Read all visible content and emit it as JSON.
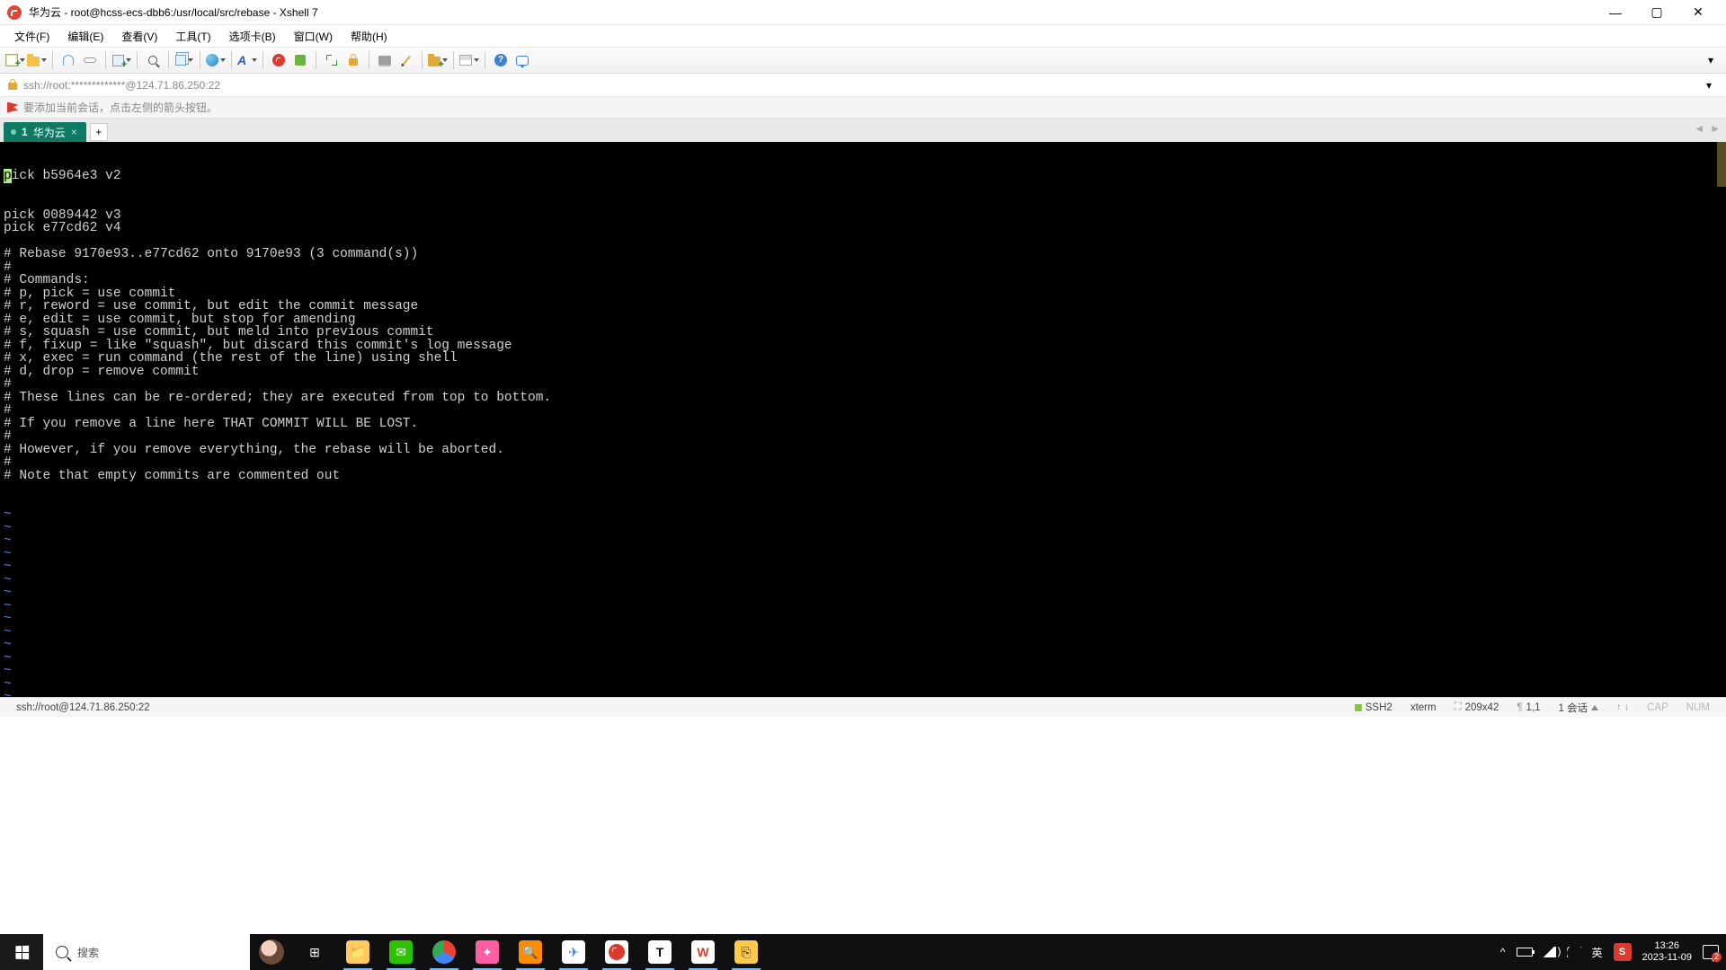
{
  "window": {
    "title": "华为云 - root@hcss-ecs-dbb6:/usr/local/src/rebase - Xshell 7",
    "minimize": "—",
    "maximize": "▢",
    "close": "✕"
  },
  "menu": {
    "file": "文件(F)",
    "edit": "编辑(E)",
    "view": "查看(V)",
    "tools": "工具(T)",
    "tabs": "选项卡(B)",
    "window": "窗口(W)",
    "help": "帮助(H)"
  },
  "address": "ssh://root:*************@124.71.86.250:22",
  "hint": "要添加当前会话，点击左侧的箭头按钮。",
  "tab": {
    "index": "1",
    "label": "华为云",
    "close": "×",
    "add": "+"
  },
  "terminal": {
    "cursor_line_prefix_char": "p",
    "cursor_line_suffix": "ick b5964e3 v2",
    "lines": [
      "pick 0089442 v3",
      "pick e77cd62 v4",
      "",
      "# Rebase 9170e93..e77cd62 onto 9170e93 (3 command(s))",
      "#",
      "# Commands:",
      "# p, pick = use commit",
      "# r, reword = use commit, but edit the commit message",
      "# e, edit = use commit, but stop for amending",
      "# s, squash = use commit, but meld into previous commit",
      "# f, fixup = like \"squash\", but discard this commit's log message",
      "# x, exec = run command (the rest of the line) using shell",
      "# d, drop = remove commit",
      "#",
      "# These lines can be re-ordered; they are executed from top to bottom.",
      "#",
      "# If you remove a line here THAT COMMIT WILL BE LOST.",
      "#",
      "# However, if you remove everything, the rebase will be aborted.",
      "#",
      "# Note that empty commits are commented out"
    ],
    "tilde": "~"
  },
  "status": {
    "left": "ssh://root@124.71.86.250:22",
    "proto": "SSH2",
    "term": "xterm",
    "size": "209x42",
    "pos": "1,1",
    "sessions": "1 会话",
    "cap": "CAP",
    "num": "NUM"
  },
  "taskbar": {
    "search_placeholder": "搜索",
    "ime": "英",
    "ime2": "S",
    "time": "13:26",
    "date": "2023-11-09",
    "notif_count": "2"
  }
}
